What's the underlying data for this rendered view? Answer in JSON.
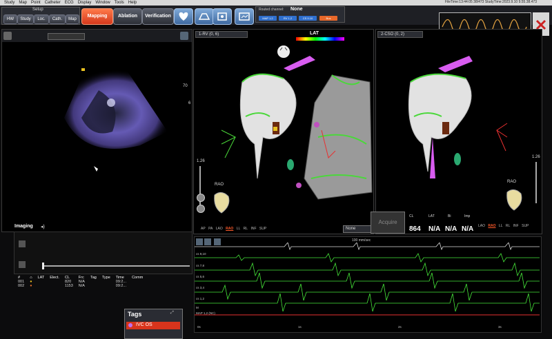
{
  "menu": [
    "Study",
    "Map",
    "Point",
    "Catheter",
    "ECG",
    "Display",
    "Window",
    "Tools",
    "Help"
  ],
  "file_info": "FileTime:13:44:05 38/473 StudyTime:2023.9.10 9.55.38.473",
  "setup": {
    "label": "Setup",
    "buttons": [
      "HW",
      "Study",
      "Loc.",
      "Cath.",
      "Map"
    ]
  },
  "modes": [
    {
      "label": "Mapping",
      "active": true
    },
    {
      "label": "Ablation",
      "active": false
    },
    {
      "label": "Verification",
      "active": false
    }
  ],
  "routed": {
    "label": "Routed channel:",
    "value": "None",
    "chips": [
      "MAP 1.2",
      "RV 1.2",
      "CS 9.10",
      "Bus"
    ]
  },
  "imaging": {
    "label": "Imaging",
    "depth_top": "70",
    "depth_bottom": "6"
  },
  "view1": {
    "title": "1-RV (0, 6)",
    "lat_label": "LAT",
    "zoom": "1.26",
    "orientation": "RAO",
    "dropdown": "None"
  },
  "view2": {
    "title": "2-CSO (0, 2)",
    "zoom": "1.26",
    "orientation": "RAO"
  },
  "views_list": [
    "AP",
    "PA",
    "LAO",
    "RAO",
    "LL",
    "RL",
    "INF",
    "SUP"
  ],
  "selected_view": "RAO",
  "acquire": {
    "button": "Acquire",
    "headers": [
      "CL",
      "LAT",
      "Bi",
      "Imp"
    ],
    "values": [
      "864",
      "N/A",
      "N/A",
      "N/A"
    ]
  },
  "points_table": {
    "headers": [
      "#",
      "",
      "LAT",
      "Elect.",
      "CL",
      "Frc",
      "Tag",
      "Type",
      "Time",
      "Comm"
    ],
    "rows": [
      {
        "id": "001",
        "lat": "",
        "elect": "",
        "cl": "820",
        "frc": "N/A",
        "tag": "",
        "type": "",
        "time": "09:2..."
      },
      {
        "id": "002",
        "lat": "",
        "elect": "",
        "cl": "1153",
        "frc": "N/A",
        "tag": "",
        "type": "",
        "time": "09:2..."
      }
    ]
  },
  "ecg": {
    "speed": "100 mm/sec",
    "leads": [
      "cs 9,10",
      "cs 7,8",
      "cs 5,6",
      "cs 3,4",
      "cs 1,2",
      "M",
      "MAP 1,2 (NC)"
    ],
    "time_ticks": [
      "0s",
      "1s",
      "2s",
      "3s"
    ]
  },
  "tags": {
    "title": "Tags",
    "item": "IVC OS"
  },
  "colors": {
    "accent": "#e8482a",
    "wave": "#47e83a",
    "mesh": "#d8d8d8",
    "lat_pink": "#d85cf0"
  }
}
